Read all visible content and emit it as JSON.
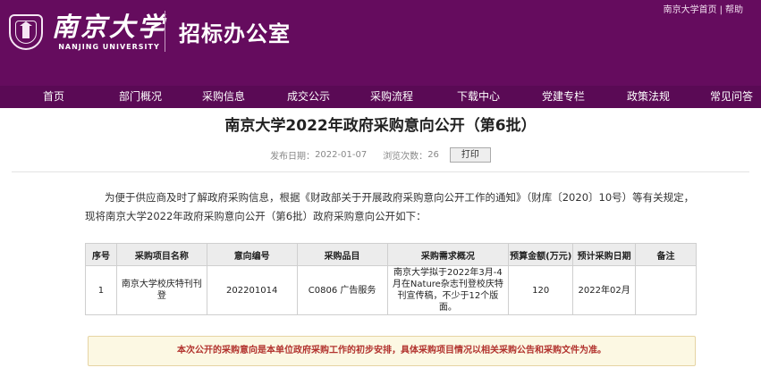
{
  "header": {
    "university_cn": "南京大学",
    "university_en": "NANJING UNIVERSITY",
    "office_name": "招标办公室",
    "top_links": [
      "南京大学首页",
      "帮助"
    ],
    "top_link_separator": "|",
    "colors": {
      "header_bg": "#650c5e",
      "nav_bg": "#5a0a55",
      "notice_text": "#b2332e"
    },
    "logo_icon": "university-seal-icon"
  },
  "nav": {
    "items": [
      "首页",
      "部门概况",
      "采购信息",
      "成交公示",
      "采购流程",
      "下载中心",
      "党建专栏",
      "政策法规",
      "常见问答"
    ]
  },
  "article": {
    "title": "南京大学2022年政府采购意向公开（第6批）",
    "publish_label": "发布日期：",
    "publish_date": "2022-01-07",
    "views_label": "浏览次数：",
    "views": "26",
    "print_label": "打印",
    "intro": "为便于供应商及时了解政府采购信息，根据《财政部关于开展政府采购意向公开工作的通知》（财库〔2020〕10号）等有关规定，现将南京大学2022年政府采购意向公开（第6批）政府采购意向公开如下："
  },
  "table": {
    "headers": [
      "序号",
      "采购项目名称",
      "意向编号",
      "采购品目",
      "采购需求概况",
      "预算金额(万元)",
      "预计采购日期",
      "备注"
    ],
    "rows": [
      [
        "1",
        "南京大学校庆特刊刊登",
        "202201014",
        "C0806 广告服务",
        "南京大学拟于2022年3月-4月在Nature杂志刊登校庆特刊宣传稿，不少于12个版面。",
        "120",
        "2022年02月",
        ""
      ]
    ]
  },
  "notice": {
    "text": "本次公开的采购意向是本单位政府采购工作的初步安排，具体采购项目情况以相关采购公告和采购文件为准。"
  }
}
